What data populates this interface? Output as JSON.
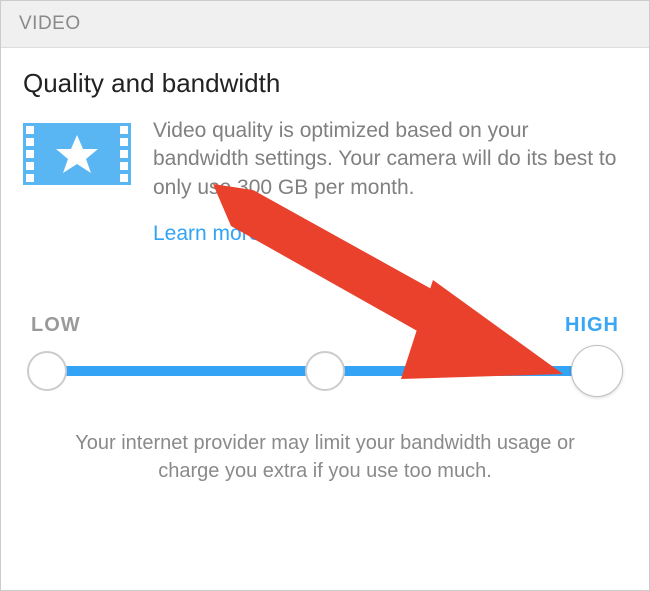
{
  "header": {
    "title": "VIDEO"
  },
  "section": {
    "title": "Quality and bandwidth",
    "description": "Video quality is optimized based on your bandwidth settings. Your camera will do its best to only use 300 GB per month.",
    "learn_more": "Learn more"
  },
  "slider": {
    "low_label": "LOW",
    "high_label": "HIGH",
    "positions": 3,
    "value_index": 2,
    "fill_percent": 93
  },
  "disclaimer": "Your internet provider may limit your bandwidth usage or charge you extra if you use too much.",
  "colors": {
    "accent": "#32a3f5",
    "arrow": "#e9412c"
  }
}
